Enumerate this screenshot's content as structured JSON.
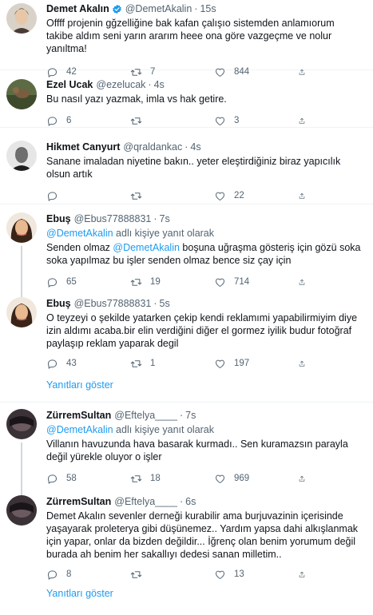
{
  "colors": {
    "accent": "#1d9bf0",
    "muted": "#536471",
    "text": "#0f1419",
    "verified": "#1d9bf0"
  },
  "icons": {
    "reply": "reply-icon",
    "retweet": "retweet-icon",
    "like": "heart-icon",
    "share": "share-icon",
    "verified": "verified-badge-icon"
  },
  "tweets": [
    {
      "name": "Demet Akalın",
      "handle": "@DemetAkalin",
      "time": "15s",
      "verified": true,
      "reply_label": "",
      "reply_mention": "",
      "reply_suffix": "",
      "text_before": "",
      "text_mention": "",
      "text": "Offff projenin gğzelliğine bak kafan çalışıo sistemden anlamıorum takibe aldım seni yarın ararım heee ona göre vazgeçme ve nolur yanıltma!",
      "replies": "42",
      "retweets": "7",
      "likes": "844"
    },
    {
      "name": "Ezel Ucak",
      "handle": "@ezelucak",
      "time": "4s",
      "verified": false,
      "text": "Bu nasıl yazı yazmak, imla vs hak getire.",
      "replies": "6",
      "retweets": "",
      "likes": "3"
    },
    {
      "name": "Hikmet Canyurt",
      "handle": "@qraldankac",
      "time": "4s",
      "verified": false,
      "text": "Sanane imaladan niyetine bakın.. yeter eleştirdiğiniz biraz yapıcılık olsun artık",
      "replies": "",
      "retweets": "",
      "likes": "22"
    },
    {
      "name": "Ebuş",
      "handle": "@Ebus77888831",
      "time": "7s",
      "verified": false,
      "reply_mention": "@DemetAkalin",
      "reply_suffix": " adlı kişiye yanıt olarak",
      "text_before": "Senden olmaz ",
      "text_mention": "@DemetAkalin",
      "text": " boşuna uğraşma gösteriş için gözü soka soka yapılmaz bu işler senden olmaz bence siz çay için",
      "replies": "65",
      "retweets": "19",
      "likes": "714"
    },
    {
      "name": "Ebuş",
      "handle": "@Ebus77888831",
      "time": "5s",
      "verified": false,
      "text": "O teyzeyi o şekilde yatarken çekip kendi reklamımi yapabilirmiyim diye izin aldımı acaba.bir elin verdiğini diğer el gormez iyilik budur fotoğraf paylaşıp reklam yaparak degil",
      "replies": "43",
      "retweets": "1",
      "likes": "197"
    },
    {
      "name": "ZürremSultan",
      "handle": "@Eftelya____",
      "time": "7s",
      "verified": false,
      "reply_mention": "@DemetAkalin",
      "reply_suffix": " adlı kişiye yanıt olarak",
      "text": "Villanın havuzunda hava basarak kurmadı.. Sen kuramazsın parayla değil yürekle oluyor o işler",
      "replies": "58",
      "retweets": "18",
      "likes": "969"
    },
    {
      "name": "ZürremSultan",
      "handle": "@Eftelya____",
      "time": "6s",
      "verified": false,
      "text": "Demet Akalın sevenler derneği kurabilir ama burjuvazinin içerisinde yaşayarak proleterya gibi düşünemez.. Yardım yapsa dahi alkışlanmak için yapar, onlar da bizden değildir... İğrenç olan benim yorumum değil burada ah benim her sakallıyı dedesi sanan milletim..",
      "replies": "8",
      "retweets": "",
      "likes": "13"
    }
  ],
  "show_replies_label": "Yanıtları göster"
}
